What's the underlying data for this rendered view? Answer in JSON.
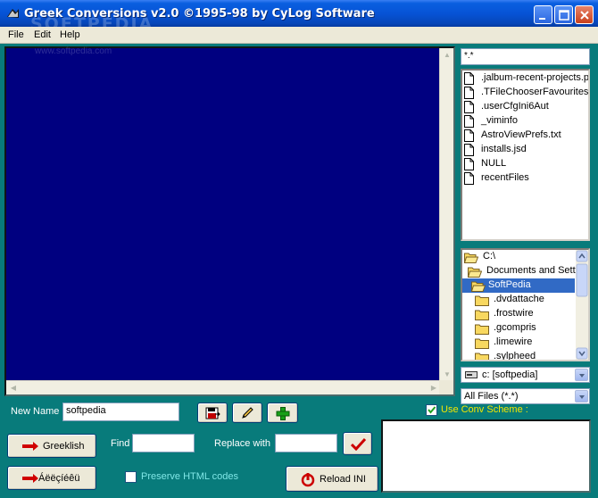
{
  "window": {
    "title": "Greek Conversions v2.0 ©1995-98 by CyLog Software",
    "watermark": "SOFTPEDIA",
    "watermark_url": "www.softpedia.com"
  },
  "menu": [
    "File",
    "Edit",
    "Help"
  ],
  "file_filter": "*.*",
  "files": [
    ".jalbum-recent-projects.pro",
    ".TFileChooserFavourites",
    ".userCfgIni6Aut",
    "_viminfo",
    "AstroViewPrefs.txt",
    "installs.jsd",
    "NULL",
    "recentFiles"
  ],
  "directories": [
    {
      "name": "C:\\",
      "open": true,
      "selected": false
    },
    {
      "name": "Documents and Settings",
      "open": true,
      "selected": false
    },
    {
      "name": "SoftPedia",
      "open": true,
      "selected": true
    },
    {
      "name": ".dvdattache",
      "open": false,
      "selected": false
    },
    {
      "name": ".frostwire",
      "open": false,
      "selected": false
    },
    {
      "name": ".gcompris",
      "open": false,
      "selected": false
    },
    {
      "name": ".limewire",
      "open": false,
      "selected": false
    },
    {
      "name": ".sylpheed",
      "open": false,
      "selected": false
    }
  ],
  "drive": "c: [softpedia]",
  "file_type": "All Files (*.*)",
  "controls": {
    "new_name_label": "New Name",
    "new_name_value": "softpedia",
    "use_conv_scheme_label": "Use Conv Scheme :",
    "use_conv_scheme_checked": true,
    "greeklish_button": "Greeklish",
    "greek_button": "Áëëçíéêü",
    "find_label": "Find",
    "find_value": "",
    "replace_label": "Replace with",
    "replace_value": "",
    "preserve_html_label": "Preserve HTML codes",
    "preserve_html_checked": false,
    "reload_button": "Reload INI"
  },
  "colors": {
    "client_bg": "#087b7b",
    "editor_bg": "#000080",
    "selection": "#316ac5",
    "check_red": "#cc0000",
    "plus_green": "#18a018"
  }
}
